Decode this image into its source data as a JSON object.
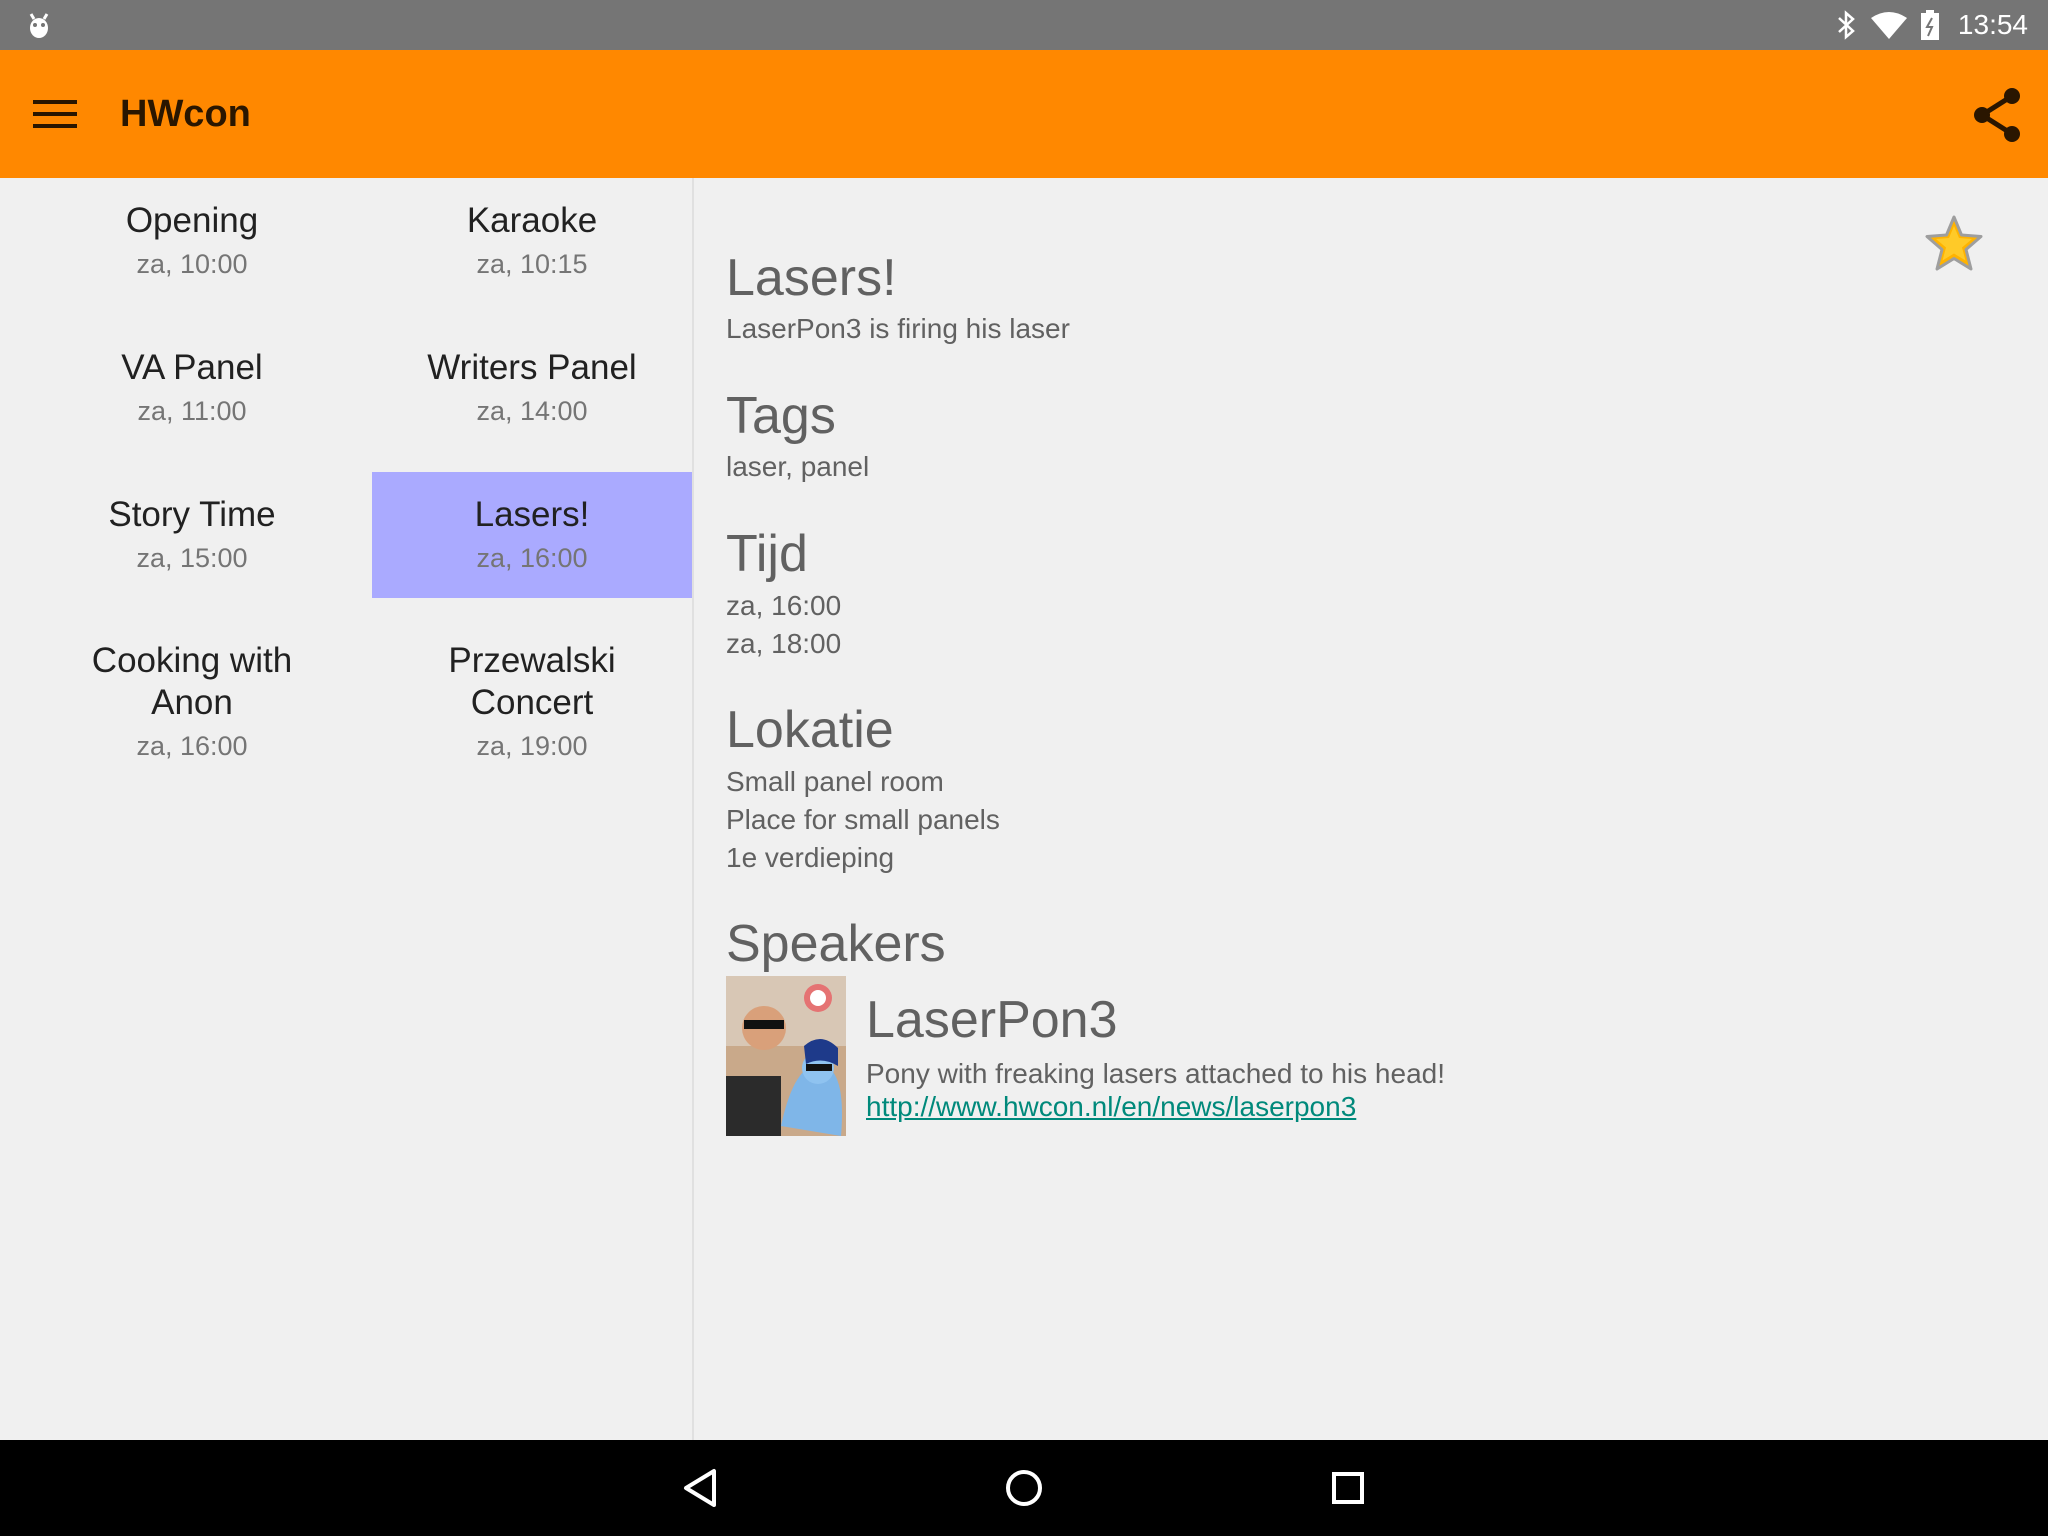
{
  "status_bar": {
    "time": "13:54",
    "icons": [
      "debug-icon",
      "bluetooth-icon",
      "wifi-icon",
      "battery-icon"
    ]
  },
  "toolbar": {
    "title": "HWcon",
    "background_color": "#ff8800",
    "menu_icon": "menu-icon",
    "share_icon": "share-icon"
  },
  "events": [
    {
      "title": "Opening",
      "time": "za, 10:00",
      "selected": false
    },
    {
      "title": "Karaoke",
      "time": "za, 10:15",
      "selected": false
    },
    {
      "title": "VA Panel",
      "time": "za, 11:00",
      "selected": false
    },
    {
      "title": "Writers Panel",
      "time": "za, 14:00",
      "selected": false
    },
    {
      "title": "Story Time",
      "time": "za, 15:00",
      "selected": false
    },
    {
      "title": "Lasers!",
      "time": "za, 16:00",
      "selected": true
    },
    {
      "title_line1": "Cooking with",
      "title_line2": "Anon",
      "time": "za, 16:00",
      "selected": false
    },
    {
      "title_line1": "Przewalski",
      "title_line2": "Concert",
      "time": "za, 19:00",
      "selected": false
    }
  ],
  "selected_color": "#aaaaff",
  "detail": {
    "title": "Lasers!",
    "description": "LaserPon3 is firing his laser",
    "tags_heading": "Tags",
    "tags": "laser, panel",
    "time_heading": "Tijd",
    "time_start": "za, 16:00",
    "time_end": "za, 18:00",
    "location_heading": "Lokatie",
    "location_name": "Small panel room",
    "location_description": "Place for small panels",
    "location_floor": "1e verdieping",
    "speakers_heading": "Speakers",
    "favorite_icon": "star-icon"
  },
  "speaker": {
    "name": "LaserPon3",
    "bio": "Pony with freaking lasers attached to his head!",
    "link": "http://www.hwcon.nl/en/news/laserpon3",
    "link_color": "#00897b"
  },
  "nav_bar": {
    "icons": [
      "back-icon",
      "home-icon",
      "recents-icon"
    ]
  }
}
